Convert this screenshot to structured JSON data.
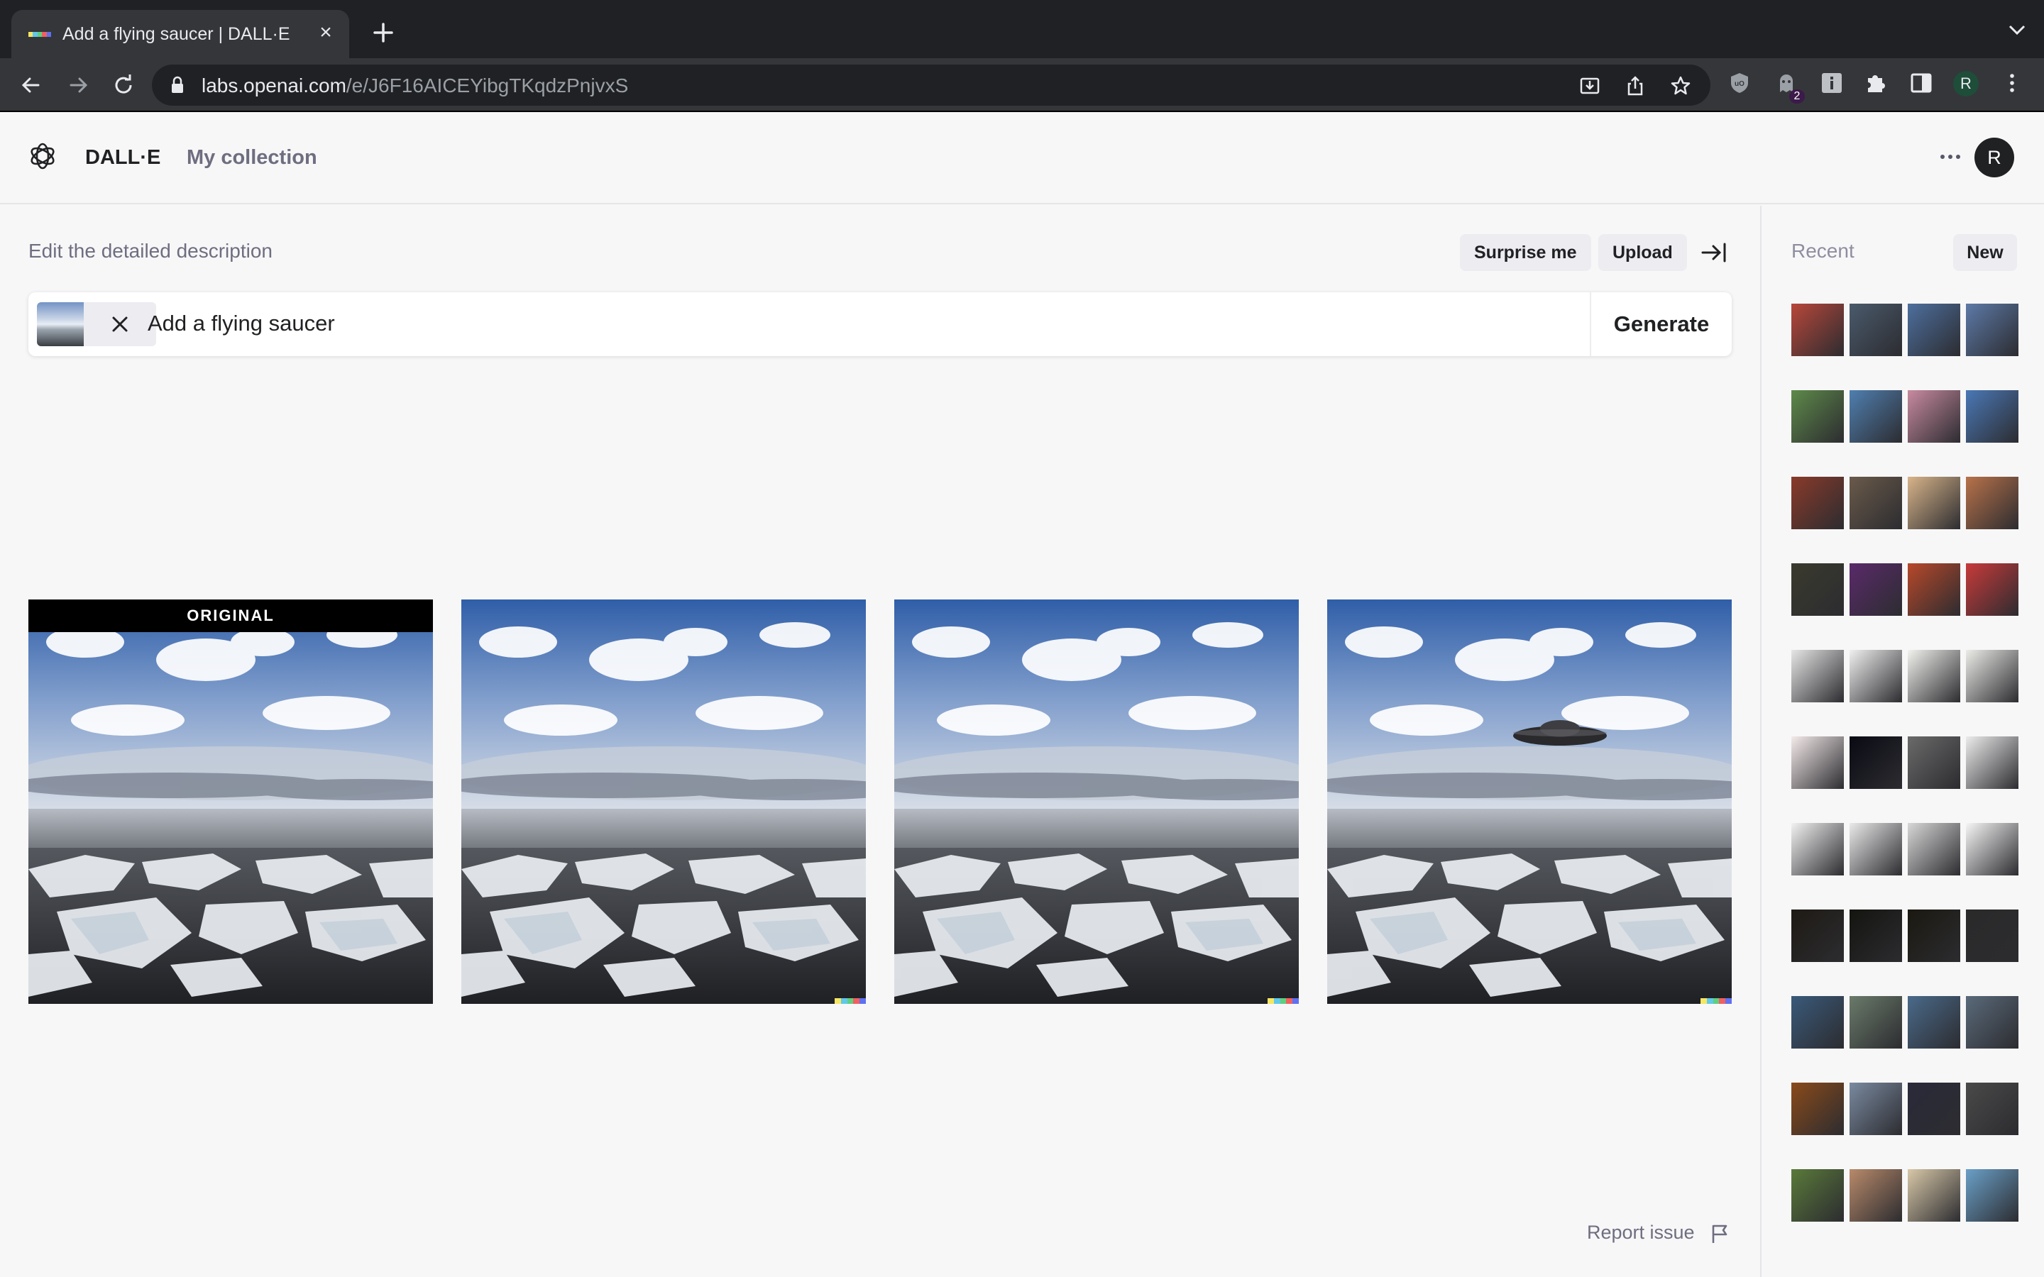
{
  "browser": {
    "tab_title": "Add a flying saucer | DALL·E",
    "url_host": "labs.openai.com",
    "url_path": "/e/J6F16AICEYibgTKqdzPnjvxS",
    "extension_badge": "2",
    "profile_initial": "R",
    "favicon_colors": [
      "#f5e663",
      "#60c8e8",
      "#5fcf80",
      "#f06060",
      "#6070f0"
    ]
  },
  "app": {
    "brand": "DALL·E",
    "nav_collection": "My collection",
    "avatar_initial": "R"
  },
  "editor": {
    "description_label": "Edit the detailed description",
    "surprise_label": "Surprise me",
    "upload_label": "Upload",
    "prompt_value": "Add a flying saucer",
    "generate_label": "Generate"
  },
  "results": {
    "original_label": "ORIGINAL",
    "images": [
      {
        "alt": "original",
        "saucer": false,
        "signature": false
      },
      {
        "alt": "variation-1",
        "saucer": false,
        "signature": true
      },
      {
        "alt": "variation-2",
        "saucer": false,
        "signature": true
      },
      {
        "alt": "variation-3",
        "saucer": true,
        "signature": true
      }
    ]
  },
  "footer": {
    "report_label": "Report issue"
  },
  "sidebar": {
    "title": "Recent",
    "new_label": "New",
    "thumb_rows": [
      [
        "#b8473a",
        "#4a5a6c",
        "#4d6f9e",
        "#5d7aa8"
      ],
      [
        "#5e8a4a",
        "#4f7fb0",
        "#c88aa0",
        "#4a78b6"
      ],
      [
        "#8a3a2a",
        "#6a5a4a",
        "#d8b48a",
        "#b8724a"
      ],
      [
        "#3a3a2e",
        "#5a2a6a",
        "#b8482a",
        "#c83a3a"
      ],
      [
        "#e6e6e6",
        "#f0f0f0",
        "#f2f2ee",
        "#ecece8"
      ],
      [
        "#f4eaea",
        "#0a0a14",
        "#6a6a6a",
        "#ececec"
      ],
      [
        "#f2f2f2",
        "#eaeaea",
        "#d8d8d8",
        "#f6f6f6"
      ],
      [
        "#1e1a14",
        "#141410",
        "#1a1810",
        "#2a2a2a"
      ],
      [
        "#3a5a7a",
        "#6a7a6a",
        "#4a6a8a",
        "#5a6a7a"
      ],
      [
        "#8a4a1a",
        "#7a8aa0",
        "#2a2a3a",
        "#4a4a4a"
      ],
      [
        "#5a7a3a",
        "#b88a6a",
        "#d8c8a8",
        "#6aa0c8"
      ]
    ]
  }
}
